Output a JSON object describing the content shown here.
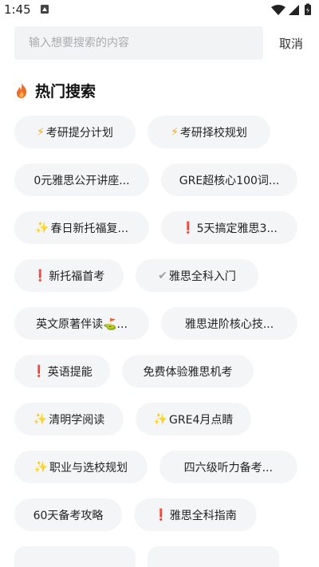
{
  "status_bar": {
    "time": "1:45"
  },
  "search": {
    "placeholder": "输入想要搜索的内容",
    "cancel_label": "取消"
  },
  "hot_search": {
    "title": "热门搜索",
    "chips": [
      [
        {
          "icon": "lightning-icon",
          "label": "考研提分计划"
        },
        {
          "icon": "lightning-icon",
          "label": "考研择校规划"
        }
      ],
      [
        {
          "icon": "",
          "label": "0元雅思公开讲座..."
        },
        {
          "icon": "",
          "label": "GRE超核心100词..."
        }
      ],
      [
        {
          "icon": "sparkles-icon",
          "label": "春日新托福复..."
        },
        {
          "icon": "exclamation-icon",
          "label": "5天搞定雅思3..."
        }
      ],
      [
        {
          "icon": "exclamation-icon",
          "label": "新托福首考"
        },
        {
          "icon": "checkmark-icon",
          "label": "雅思全科入门"
        }
      ],
      [
        {
          "icon": "",
          "label": "英文原著伴读⛳..."
        },
        {
          "icon": "",
          "label": "雅思进阶核心技..."
        }
      ],
      [
        {
          "icon": "exclamation-icon",
          "label": "英语提能"
        },
        {
          "icon": "",
          "label": "免费体验雅思机考"
        }
      ],
      [
        {
          "icon": "sparkles-icon",
          "label": "清明学阅读"
        },
        {
          "icon": "sparkles-icon",
          "label": "GRE4月点睛"
        }
      ],
      [
        {
          "icon": "sparkles-icon",
          "label": "职业与选校规划"
        },
        {
          "icon": "",
          "label": "四六级听力备考..."
        }
      ],
      [
        {
          "icon": "",
          "label": "60天备考攻略"
        },
        {
          "icon": "exclamation-icon",
          "label": "雅思全科指南"
        }
      ]
    ]
  },
  "colors": {
    "chip_bg": "#f4f5f7",
    "search_bg": "#f2f3f5",
    "accent_fire": "#f06a2a"
  }
}
